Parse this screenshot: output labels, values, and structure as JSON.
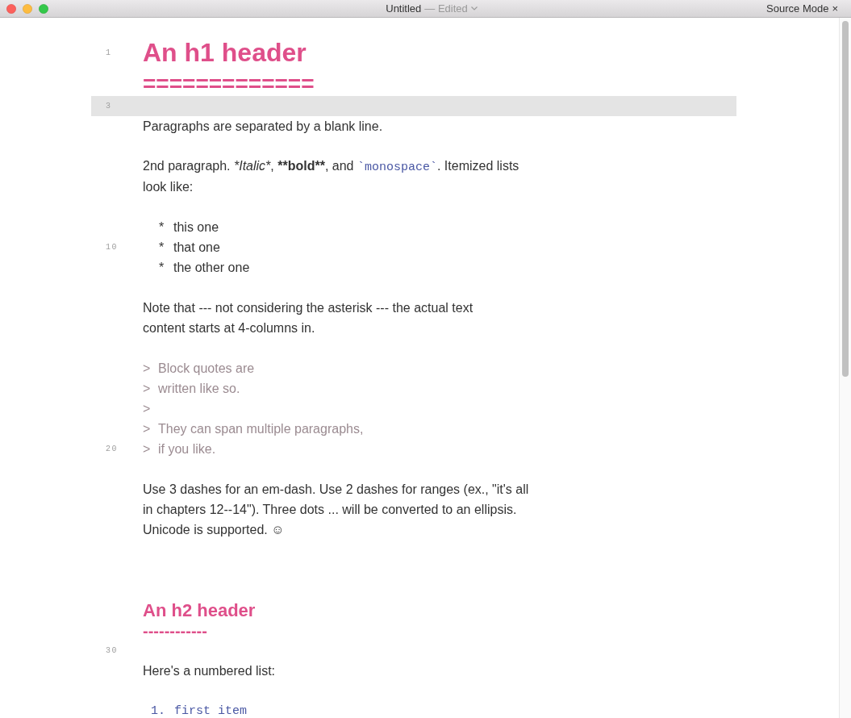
{
  "window": {
    "title": "Untitled",
    "status": "— Edited",
    "mode_label": "Source Mode",
    "mode_close": "×"
  },
  "lines": [
    {
      "number": "1",
      "kind": "h1",
      "text": "An h1 header",
      "current": false
    },
    {
      "kind": "h1_rule",
      "text": "=============",
      "current": false
    },
    {
      "number": "3",
      "kind": "blank",
      "current": true
    },
    {
      "kind": "paragraph",
      "text": "Paragraphs are separated by a blank line.",
      "current": false
    },
    {
      "kind": "blank",
      "current": false
    },
    {
      "kind": "paragraph",
      "segments": [
        {
          "text": "2nd paragraph. ",
          "kind": "plain"
        },
        {
          "text": "*Italic*",
          "kind": "italic"
        },
        {
          "text": ", ",
          "kind": "plain"
        },
        {
          "text": "**bold**",
          "kind": "bold"
        },
        {
          "text": ", and ",
          "kind": "plain"
        },
        {
          "text": "`monospace`",
          "kind": "code"
        },
        {
          "text": ". Itemized lists",
          "kind": "plain"
        }
      ],
      "current": false
    },
    {
      "kind": "paragraph",
      "text": "look like:",
      "current": false
    },
    {
      "kind": "blank",
      "current": false
    },
    {
      "kind": "bullet",
      "marker": "*",
      "text": "this one",
      "current": false
    },
    {
      "number": "10",
      "kind": "bullet",
      "marker": "*",
      "text": "that one",
      "current": false
    },
    {
      "kind": "bullet",
      "marker": "*",
      "text": "the other one",
      "current": false
    },
    {
      "kind": "blank",
      "current": false
    },
    {
      "kind": "paragraph",
      "text": "Note that --- not considering the asterisk --- the actual text",
      "current": false
    },
    {
      "kind": "paragraph",
      "text": "content starts at 4-columns in.",
      "current": false
    },
    {
      "kind": "blank",
      "current": false
    },
    {
      "kind": "quote",
      "marker": ">",
      "text": "Block quotes are",
      "current": false
    },
    {
      "kind": "quote",
      "marker": ">",
      "text": "written like so.",
      "current": false
    },
    {
      "kind": "quote",
      "marker": ">",
      "current": false
    },
    {
      "kind": "quote",
      "marker": ">",
      "text": "They can span multiple paragraphs,",
      "current": false
    },
    {
      "number": "20",
      "kind": "quote",
      "marker": ">",
      "text": "if you like.",
      "current": false
    },
    {
      "kind": "blank",
      "current": false
    },
    {
      "kind": "paragraph",
      "text": "Use 3 dashes for an em-dash. Use 2 dashes for ranges (ex., \"it's all",
      "current": false
    },
    {
      "kind": "paragraph",
      "text": "in chapters 12--14\"). Three dots ... will be converted to an ellipsis.",
      "current": false
    },
    {
      "kind": "paragraph",
      "text": "Unicode is supported. ☺",
      "current": false
    },
    {
      "kind": "blank",
      "current": false
    },
    {
      "kind": "blank",
      "current": false
    },
    {
      "kind": "blank",
      "current": false
    },
    {
      "kind": "h2",
      "text": "An h2 header",
      "current": false
    },
    {
      "kind": "h2_rule",
      "text": "------------",
      "current": false
    },
    {
      "number": "30",
      "kind": "blank",
      "current": false
    },
    {
      "kind": "paragraph",
      "text": "Here's a numbered list:",
      "current": false
    },
    {
      "kind": "blank",
      "current": false
    },
    {
      "kind": "ordered",
      "marker": "1.",
      "text": "first item",
      "current": false
    }
  ]
}
